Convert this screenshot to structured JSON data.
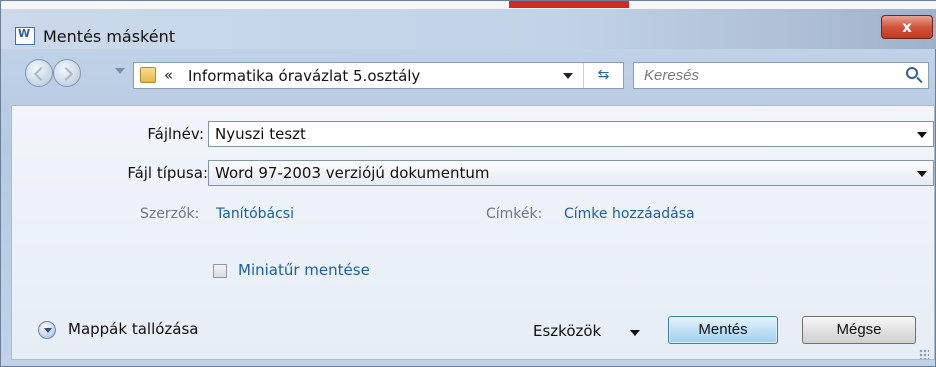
{
  "window": {
    "title": "Mentés másként",
    "close_glyph": "x"
  },
  "nav": {
    "address_prefix": "«",
    "address_path": "Informatika óravázlat 5.osztály",
    "refresh_glyph": "⇆",
    "search_placeholder": "Keresés"
  },
  "form": {
    "filename_label": "Fájlnév:",
    "filename_value": "Nyuszi teszt",
    "filetype_label": "Fájl típusa:",
    "filetype_value": "Word 97-2003 verziójú dokumentum",
    "authors_label": "Szerzők:",
    "authors_value": "Tanítóbácsi",
    "tags_label": "Címkék:",
    "tags_value": "Címke hozzáadása",
    "thumbnail_label": "Miniatűr mentése",
    "thumbnail_checked": false
  },
  "footer": {
    "browse_folders": "Mappák tallózása",
    "tools": "Eszközök",
    "save": "Mentés",
    "cancel": "Mégse"
  },
  "colors": {
    "link": "#1a5fa8",
    "primary_button": "#bfe0f5",
    "close_button": "#d0553c"
  }
}
